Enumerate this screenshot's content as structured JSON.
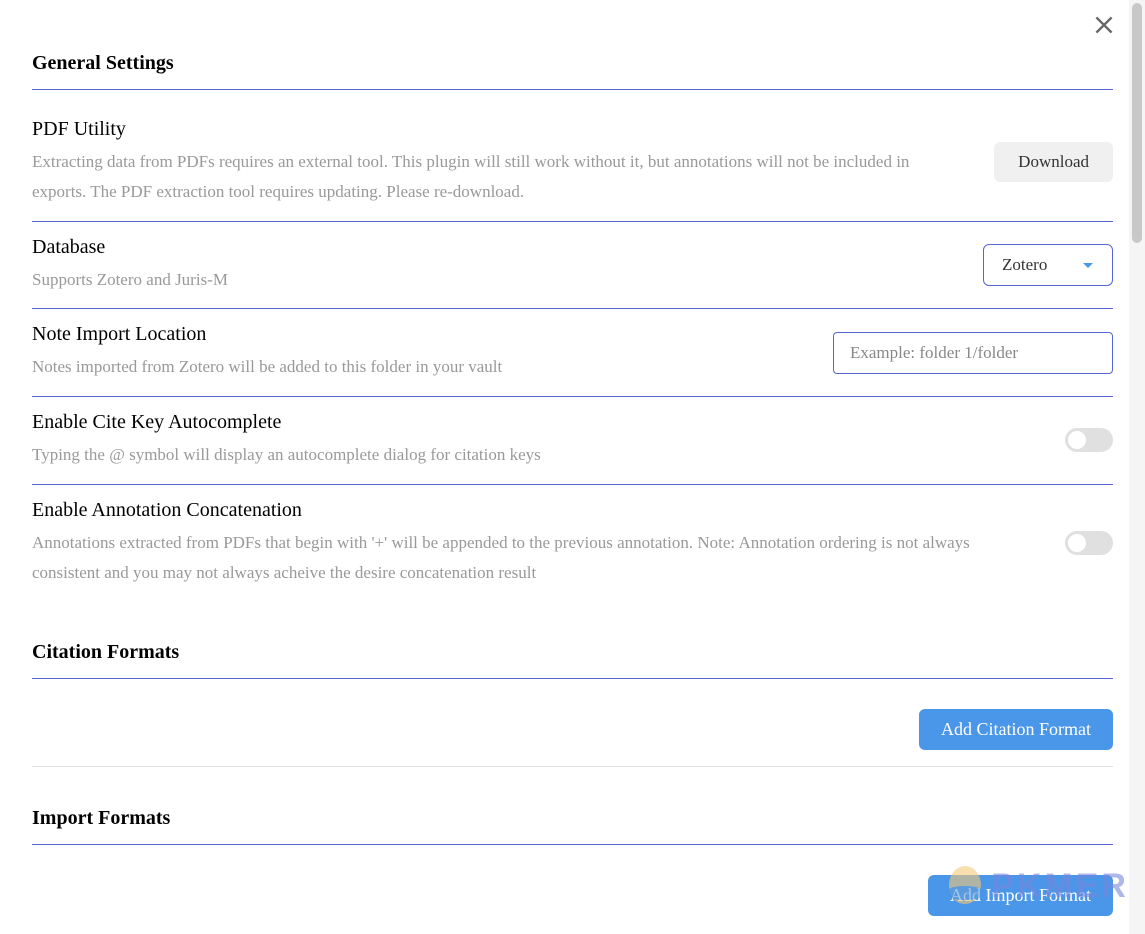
{
  "sections": {
    "general": {
      "heading": "General Settings",
      "pdf_utility": {
        "title": "PDF Utility",
        "desc": "Extracting data from PDFs requires an external tool. This plugin will still work without it, but annotations will not be included in exports. The PDF extraction tool requires updating. Please re-download.",
        "button": "Download"
      },
      "database": {
        "title": "Database",
        "desc": "Supports Zotero and Juris-M",
        "selected": "Zotero"
      },
      "note_import": {
        "title": "Note Import Location",
        "desc": "Notes imported from Zotero will be added to this folder in your vault",
        "placeholder": "Example: folder 1/folder"
      },
      "cite_key": {
        "title": "Enable Cite Key Autocomplete",
        "desc": "Typing the @ symbol will display an autocomplete dialog for citation keys"
      },
      "annotation_concat": {
        "title": "Enable Annotation Concatenation",
        "desc": "Annotations extracted from PDFs that begin with '+' will be appended to the previous annotation. Note: Annotation ordering is not always consistent and you may not always acheive the desire concatenation result"
      }
    },
    "citation_formats": {
      "heading": "Citation Formats",
      "button": "Add Citation Format"
    },
    "import_formats": {
      "heading": "Import Formats",
      "button": "Add Import Format"
    }
  },
  "watermark": "PKMER"
}
